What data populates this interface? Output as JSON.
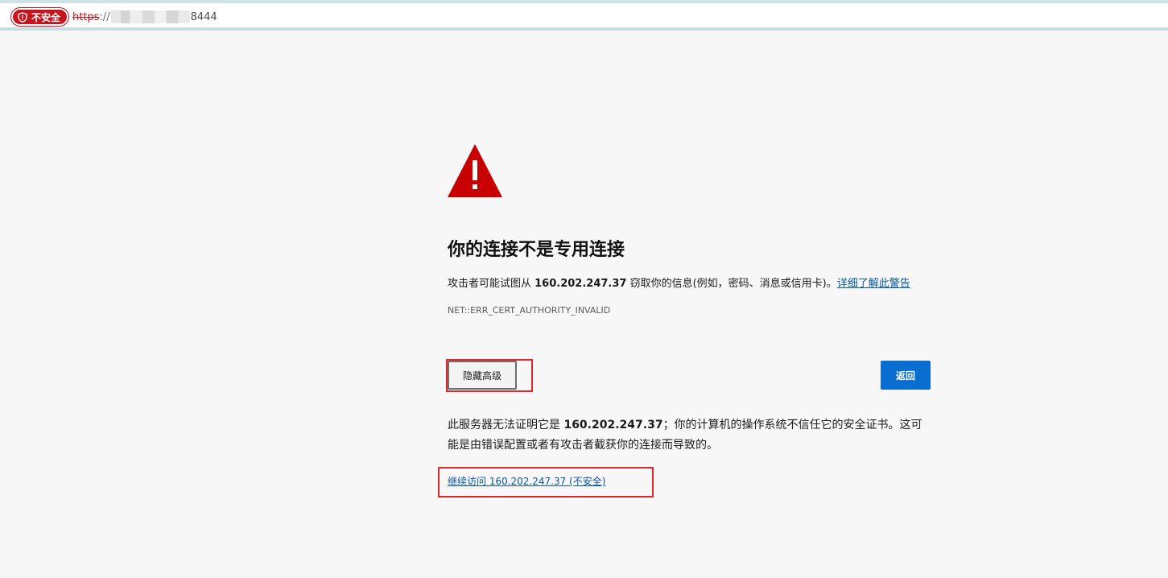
{
  "addressbar": {
    "security_label": "不安全",
    "url_scheme": "https",
    "url_separator": "://",
    "url_port": "8444",
    "security_color": "#c4141d"
  },
  "page": {
    "icon": "warning-triangle-icon",
    "title": "你的连接不是专用连接",
    "description_prefix": "攻击者可能试图从 ",
    "host": "160.202.247.37",
    "description_suffix": " 窃取你的信息(例如，密码、消息或信用卡)。",
    "learn_more_label": "详细了解此警告",
    "error_code": "NET::ERR_CERT_AUTHORITY_INVALID",
    "advanced_button_label": "隐藏高级",
    "back_button_label": "返回",
    "details_prefix": "此服务器无法证明它是 ",
    "details_suffix": "；你的计算机的操作系统不信任它的安全证书。这可能是由错误配置或者有攻击者截获你的连接而导致的。",
    "proceed_link_label": "继续访问 160.202.247.37 (不安全)",
    "accent_color": "#0a6ed1",
    "warning_color": "#c80000",
    "highlight_color": "#e0262e"
  }
}
